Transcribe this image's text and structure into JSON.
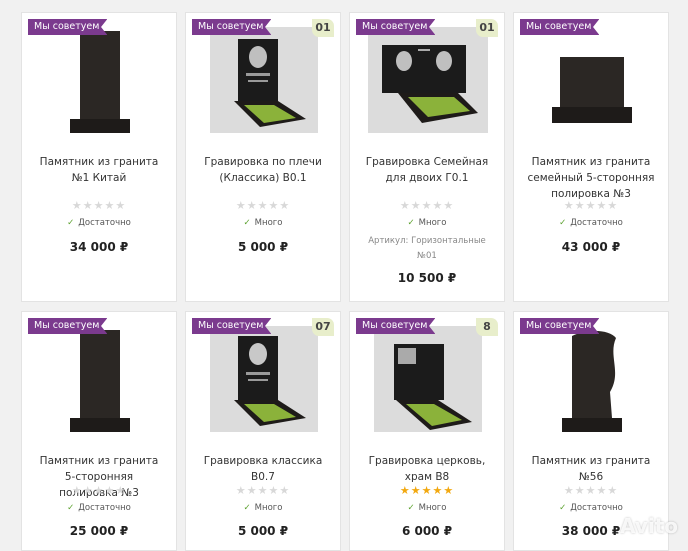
{
  "badge_label": "Мы советуем",
  "watermark": "Avito",
  "products": [
    {
      "title": "Памятник из гранита №1 Китай",
      "stock": "Достаточно",
      "price": "34 000 ₽",
      "rating": 0
    },
    {
      "title": "Гравировка по плечи (Классика) В0.1",
      "stock": "Много",
      "price": "5 000 ₽",
      "rating": 0,
      "number": "01"
    },
    {
      "title": "Гравировка Семейная для двоих Г0.1",
      "stock": "Много",
      "article": "Артикул: Горизонтальные №01",
      "price": "10 500 ₽",
      "rating": 0,
      "number": "01"
    },
    {
      "title": "Памятник из гранита семейный 5-сторонняя полировка №3",
      "stock": "Достаточно",
      "price": "43 000 ₽",
      "rating": 0
    },
    {
      "title": "Памятник из гранита 5-сторонняя полировка №3",
      "stock": "Достаточно",
      "price": "25 000 ₽",
      "rating": 0
    },
    {
      "title": "Гравировка классика В0.7",
      "stock": "Много",
      "price": "5 000 ₽",
      "rating": 0,
      "number": "07"
    },
    {
      "title": "Гравировка церковь, храм В8",
      "stock": "Много",
      "price": "6 000 ₽",
      "rating": 5,
      "number": "8"
    },
    {
      "title": "Памятник из гранита №56",
      "stock": "Достаточно",
      "price": "38 000 ₽",
      "rating": 0
    }
  ]
}
